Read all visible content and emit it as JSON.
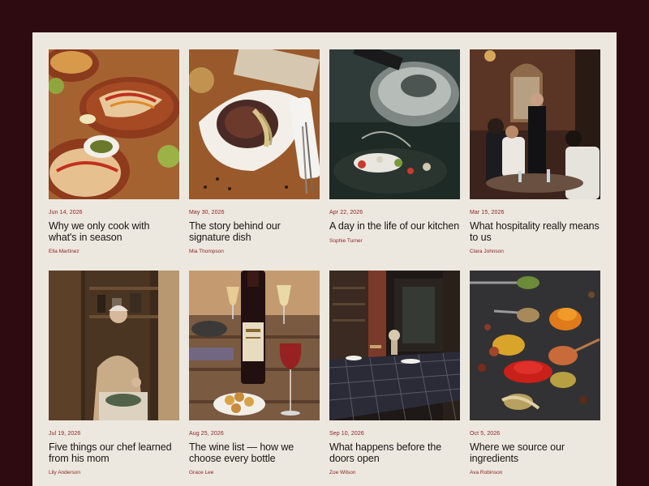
{
  "colors": {
    "outer_background": "#2e0b11",
    "page_background": "#ece8df",
    "accent": "#8a1f1f",
    "title_text": "#1c1414"
  },
  "posts": [
    {
      "date": "Jun 14, 2026",
      "title": "Why we only cook with what's in season",
      "author": "Ella Martinez",
      "image": "tacos-on-wooden-table-photo"
    },
    {
      "date": "May 30, 2026",
      "title": "The story behind our signature dish",
      "author": "Mia Thompson",
      "image": "plated-signature-dish-photo"
    },
    {
      "date": "Apr 22, 2026",
      "title": "A day in the life of our kitchen",
      "author": "Sophie Turner",
      "image": "kitchen-pan-closeup-photo"
    },
    {
      "date": "Mar 15, 2026",
      "title": "What hospitality really means to us",
      "author": "Clara Johnson",
      "image": "dining-room-guests-photo"
    },
    {
      "date": "Jul 19, 2026",
      "title": "Five things our chef learned from his mom",
      "author": "Lily Anderson",
      "image": "woman-cooking-at-home-photo"
    },
    {
      "date": "Aug 25, 2026",
      "title": "The wine list — how we choose every bottle",
      "author": "Grace Lee",
      "image": "wine-bottle-and-glasses-photo"
    },
    {
      "date": "Sep 10, 2026",
      "title": "What happens before the doors open",
      "author": "Zoe Wilson",
      "image": "empty-restaurant-interior-photo"
    },
    {
      "date": "Oct 5, 2026",
      "title": "Where we source our ingredients",
      "author": "Ava Robinson",
      "image": "spices-on-spoons-photo"
    }
  ]
}
